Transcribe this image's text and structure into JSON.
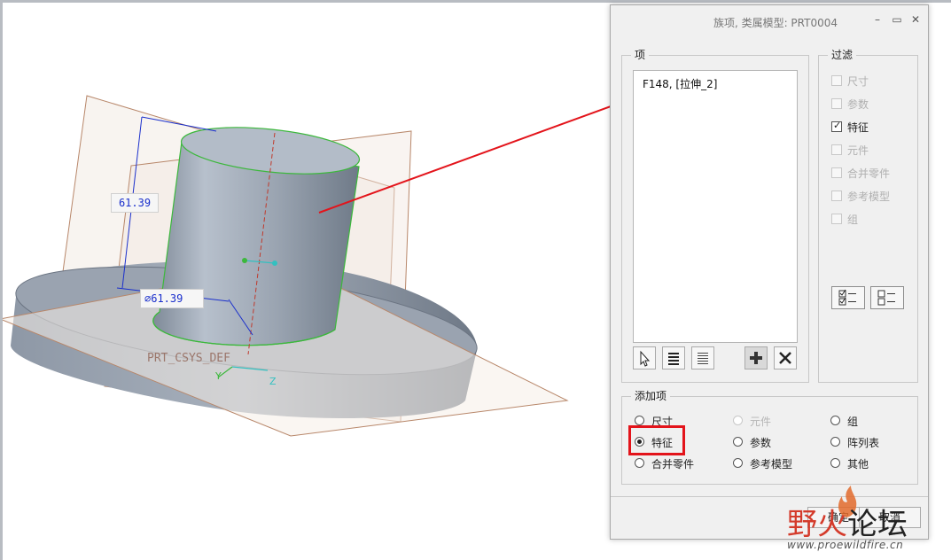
{
  "viewport": {
    "dim_vertical": "61.39",
    "dim_diameter": "61.39",
    "csys_label": "PRT_CSYS_DEF",
    "axis_y": "Y",
    "axis_z": "Z"
  },
  "dialog": {
    "title": "族项,  类属模型: PRT0004",
    "minimize_icon": "minimize-icon",
    "maximize_icon": "maximize-icon",
    "close_icon": "close-icon",
    "items_group": {
      "title": "项",
      "list": [
        "F148, [拉伸_2]"
      ]
    },
    "filter_group": {
      "title": "过滤",
      "options": [
        {
          "label": "尺寸",
          "checked": false,
          "enabled": false
        },
        {
          "label": "参数",
          "checked": false,
          "enabled": false
        },
        {
          "label": "特征",
          "checked": true,
          "enabled": true
        },
        {
          "label": "元件",
          "checked": false,
          "enabled": false
        },
        {
          "label": "合并零件",
          "checked": false,
          "enabled": false
        },
        {
          "label": "参考模型",
          "checked": false,
          "enabled": false
        },
        {
          "label": "组",
          "checked": false,
          "enabled": false
        }
      ]
    },
    "add_group": {
      "title": "添加项",
      "options": [
        {
          "label": "尺寸",
          "selected": false,
          "enabled": true
        },
        {
          "label": "元件",
          "selected": false,
          "enabled": false
        },
        {
          "label": "组",
          "selected": false,
          "enabled": true
        },
        {
          "label": "特征",
          "selected": true,
          "enabled": true
        },
        {
          "label": "参数",
          "selected": false,
          "enabled": true
        },
        {
          "label": "阵列表",
          "selected": false,
          "enabled": true
        },
        {
          "label": "合并零件",
          "selected": false,
          "enabled": true
        },
        {
          "label": "参考模型",
          "selected": false,
          "enabled": true
        },
        {
          "label": "其他",
          "selected": false,
          "enabled": true
        }
      ]
    },
    "ok_label": "确定",
    "cancel_label": "取消"
  },
  "watermark": {
    "title_red": "野火",
    "title_dark": "论坛",
    "url": "www.proewildfire.cn"
  },
  "colors": {
    "annotation_red": "#e3141b",
    "model_gray": "#9aa4b1",
    "edge_green": "#3cb83c",
    "datum_plane": "#b8876a",
    "dimension_blue": "#1a2fcc"
  }
}
